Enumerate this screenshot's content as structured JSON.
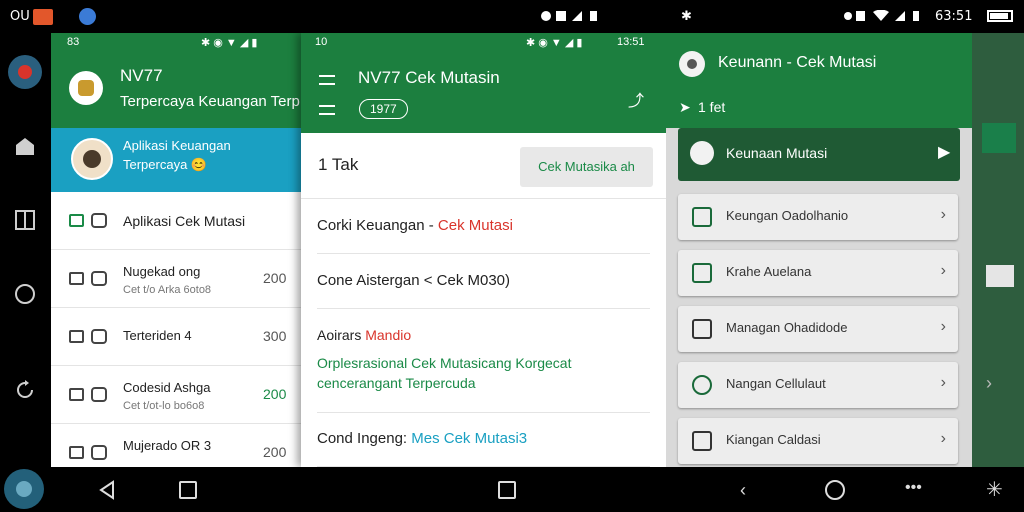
{
  "statusbar": {
    "left_text": "OU",
    "right_time": "63:51"
  },
  "panel1": {
    "status_left": "83",
    "status_time": "",
    "app_name": "NV77",
    "app_subtitle": "Terpercaya Keuangan Terp",
    "account_name": "Aplikasi Keuangan",
    "account_sub": "Terpercaya 😊",
    "section_title": "Aplikasi Cek Mutasi",
    "items": [
      {
        "title": "Nugekad ong",
        "sub": "Cet t/o Arka 6oto8",
        "num": "200"
      },
      {
        "title": "Terteriden 4",
        "sub": "",
        "num": "300"
      },
      {
        "title": "Codesid Ashga",
        "sub": "Cet t/ot-lo bo6o8",
        "num": "200"
      },
      {
        "title": "Mujerado OR 3",
        "sub": "",
        "num": "200"
      }
    ]
  },
  "panel2": {
    "status_left": "10",
    "status_time": "13:51",
    "title": "NV77 Cek Mutasin",
    "badge": "1977",
    "count_label": "1 Tak",
    "cek_button": "Cek Mutasika ah",
    "rows": [
      {
        "label": "Corki Keuangan - ",
        "accent": "Cek Mutasi"
      },
      {
        "label": "Cone Aistergan < Cek M030)",
        "accent": ""
      },
      {
        "label": "Aoirars ",
        "accent": "Mandio",
        "desc1": "Orplesrasional Cek Mutasicang Korgecat",
        "desc2": "cencerangant Terpercuda"
      },
      {
        "label": "Cond Ingeng:  ",
        "accent": "Mes Cek Mutasi3"
      }
    ]
  },
  "panel3": {
    "title": "Keunann - Cek Mutasi",
    "sub_label": "1 fet",
    "active_item": "Keunaan Mutasi",
    "items": [
      "Keungan Oadolhanio",
      "Krahe Auelana",
      "Managan Ohadidode",
      "Nangan Cellulaut",
      "Kiangan Caldasi"
    ]
  },
  "colors": {
    "header_green": "#1c7f3f",
    "account_cyan": "#1aa0c2",
    "accent_red": "#d9342b",
    "accent_teal": "#1aa0c2",
    "desc_green": "#1a8a47"
  }
}
